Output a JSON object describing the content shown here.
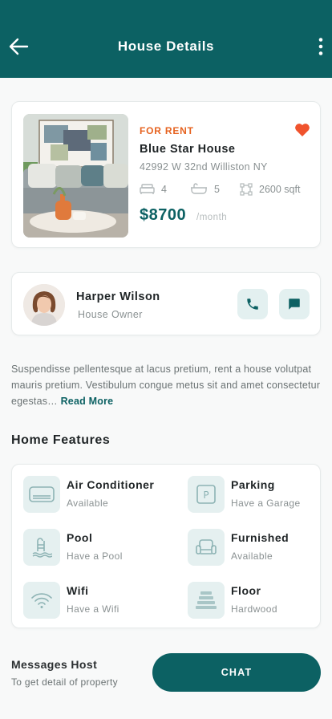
{
  "header": {
    "title": "House Details"
  },
  "property": {
    "status": "FOR RENT",
    "name": "Blue Star House",
    "address": "42992 W 32nd Williston NY",
    "beds": "4",
    "baths": "5",
    "area": "2600 sqft",
    "price": "$8700",
    "period": "/month",
    "favorited": true
  },
  "owner": {
    "name": "Harper Wilson",
    "role": "House Owner"
  },
  "description": {
    "text": "Suspendisse pellentesque at lacus pretium, rent a house volutpat mauris pretium. Vestibulum congue metus sit and amet consectetur egestas…",
    "read_more": "Read More"
  },
  "features_title": "Home Features",
  "features": [
    {
      "name": "Air Conditioner",
      "desc": "Available",
      "icon": "air-conditioner-icon"
    },
    {
      "name": "Parking",
      "desc": "Have a Garage",
      "icon": "parking-icon"
    },
    {
      "name": "Pool",
      "desc": "Have a Pool",
      "icon": "pool-icon"
    },
    {
      "name": "Furnished",
      "desc": "Available",
      "icon": "sofa-icon"
    },
    {
      "name": "Wifi",
      "desc": "Have a Wifi",
      "icon": "wifi-icon"
    },
    {
      "name": "Floor",
      "desc": "Hardwood",
      "icon": "floor-icon"
    }
  ],
  "footer": {
    "title": "Messages Host",
    "subtitle": "To get detail of property",
    "chat_label": "CHAT"
  },
  "colors": {
    "primary": "#0c6163",
    "accent": "#e6621f",
    "heart": "#f0532d"
  }
}
